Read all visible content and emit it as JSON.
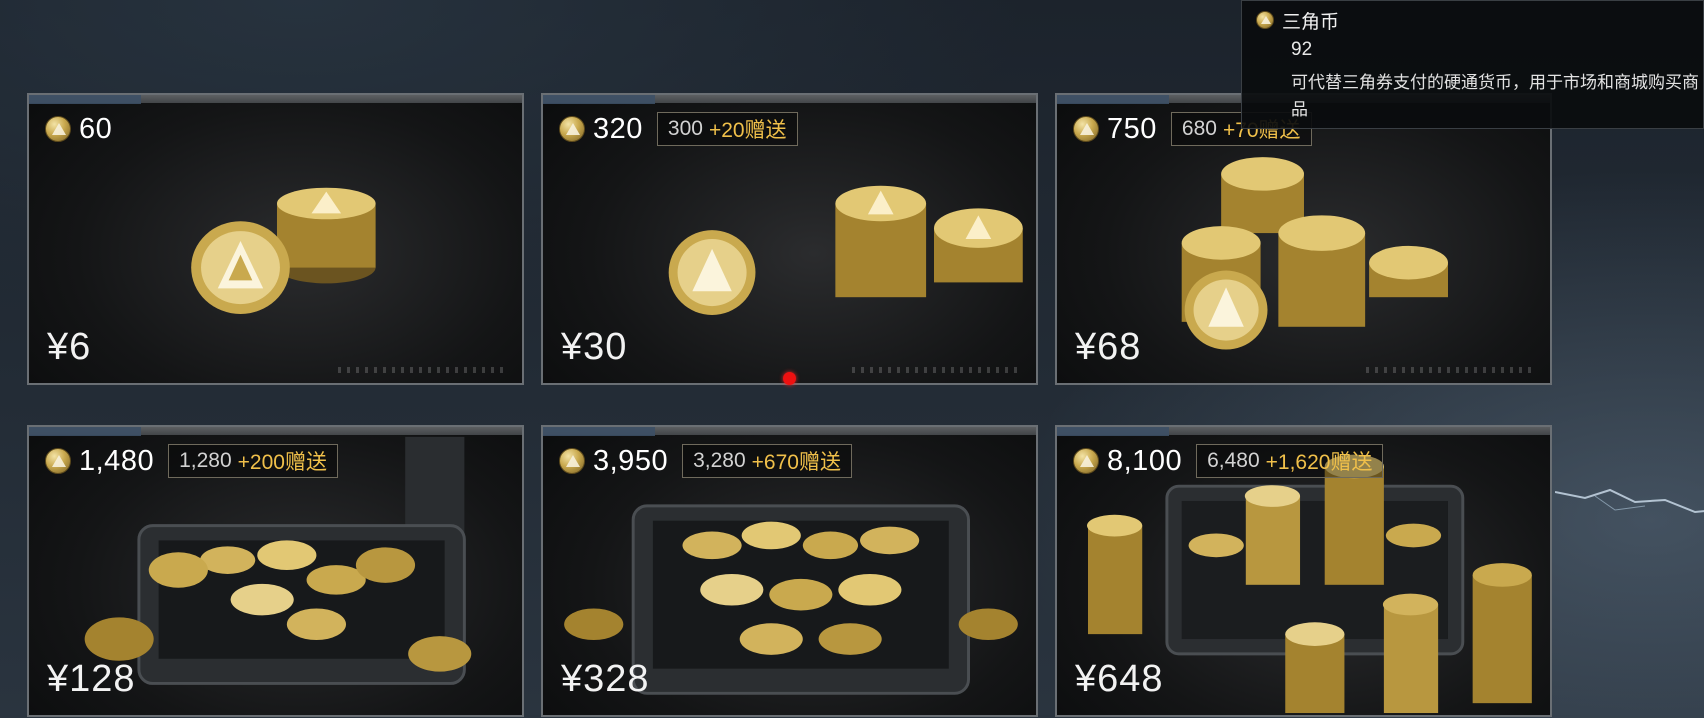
{
  "currency": {
    "name": "三角币",
    "count": "92",
    "description": "可代替三角券支付的硬通货币，用于市场和商城购买商品"
  },
  "packs": [
    {
      "amount": "60",
      "bonus_base": "",
      "bonus_extra": "",
      "price": "¥6"
    },
    {
      "amount": "320",
      "bonus_base": "300",
      "bonus_extra": "+20赠送",
      "price": "¥30"
    },
    {
      "amount": "750",
      "bonus_base": "680",
      "bonus_extra": "+70赠送",
      "price": "¥68"
    },
    {
      "amount": "1,480",
      "bonus_base": "1,280",
      "bonus_extra": "+200赠送",
      "price": "¥128"
    },
    {
      "amount": "3,950",
      "bonus_base": "3,280",
      "bonus_extra": "+670赠送",
      "price": "¥328"
    },
    {
      "amount": "8,100",
      "bonus_base": "6,480",
      "bonus_extra": "+1,620赠送",
      "price": "¥648"
    }
  ],
  "colors": {
    "gold": "#f0c04a",
    "card_border": "#6a6f74",
    "tooltip_bg": "#0a0c0e",
    "marker": "#e11111"
  },
  "icons": {
    "currency": "triangle-coin-icon"
  }
}
